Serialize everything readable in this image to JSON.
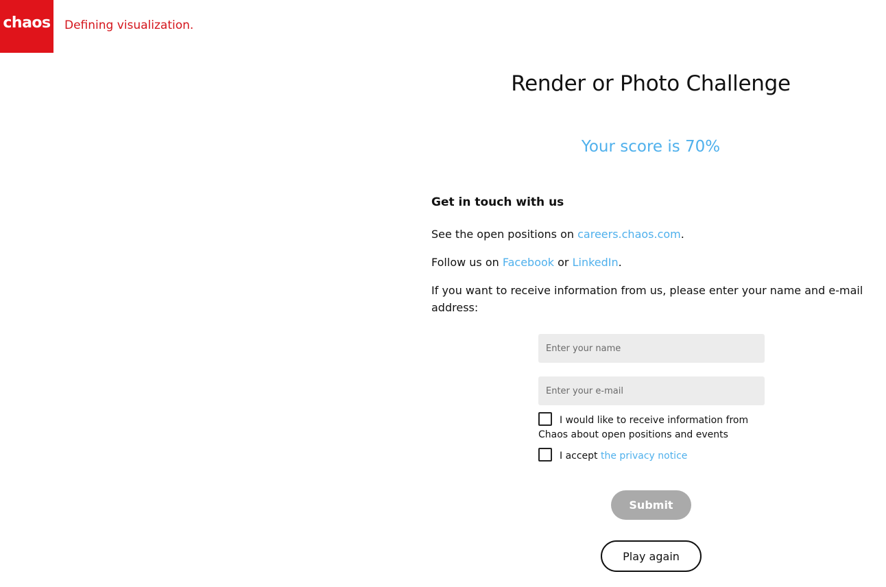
{
  "header": {
    "logo_text": "chaos",
    "tagline": "Defining visualization."
  },
  "main": {
    "title": "Render or Photo Challenge",
    "score": "Your score is 70%",
    "contact_heading": "Get in touch with us",
    "positions": {
      "prefix": "See the open positions on ",
      "link": "careers.chaos.com",
      "suffix": "."
    },
    "follow": {
      "prefix": "Follow us on ",
      "facebook": "Facebook",
      "or": " or ",
      "linkedin": "LinkedIn",
      "suffix": "."
    },
    "info_text": "If you want to receive information from us, please enter your name and e-mail address:"
  },
  "form": {
    "name_placeholder": "Enter your name",
    "email_placeholder": "Enter your e-mail",
    "opt_in_label": "I would like to receive information from Chaos about open positions and events",
    "privacy_prefix": "I accept ",
    "privacy_link": "the privacy notice",
    "submit_label": "Submit",
    "play_again_label": "Play again"
  },
  "colors": {
    "brand_red": "#e0141b",
    "link_blue": "#4fb0ec",
    "submit_disabled": "#aaaaaa"
  }
}
